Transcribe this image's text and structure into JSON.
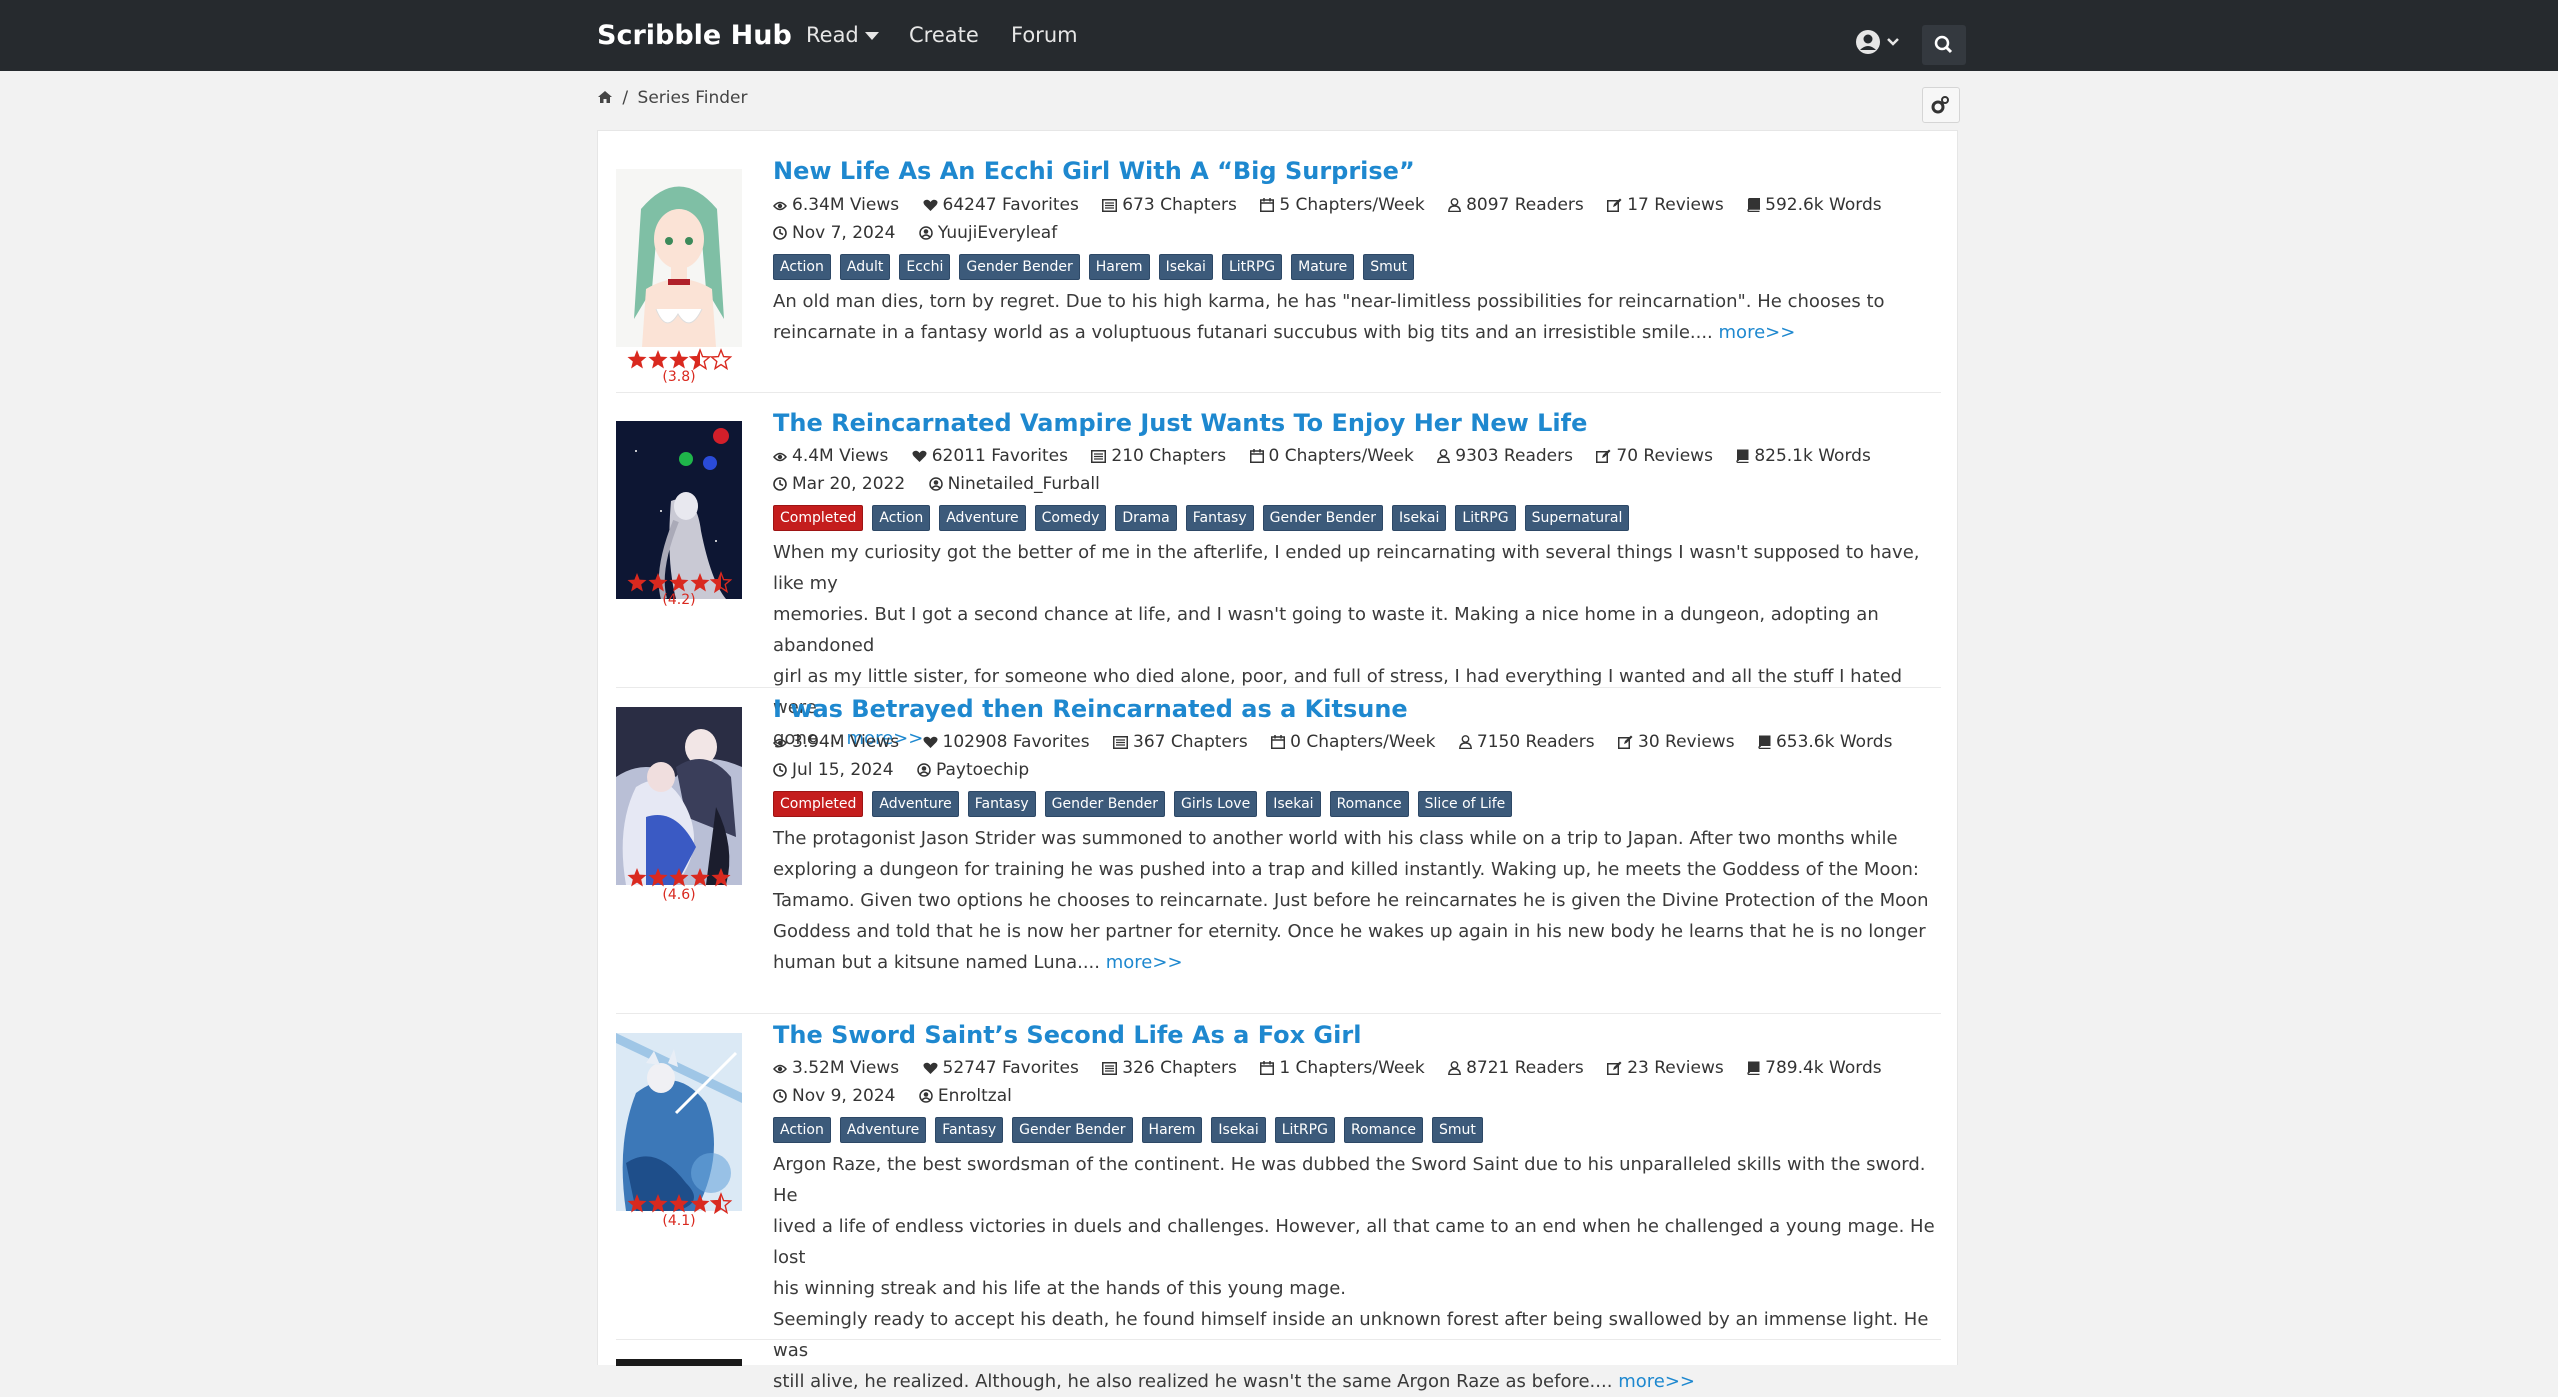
{
  "navbar": {
    "brand": "Scribble Hub",
    "links": {
      "read": "Read",
      "create": "Create",
      "forum": "Forum"
    }
  },
  "breadcrumb": {
    "home_icon": "home-icon",
    "separator": "/",
    "current": "Series Finder"
  },
  "series": [
    {
      "title": "New Life As An Ecchi Girl With A “Big Surprise”",
      "views": "6.34M Views",
      "favorites": "64247 Favorites",
      "chapters": "673 Chapters",
      "per_week": "5 Chapters/Week",
      "readers": "8097 Readers",
      "reviews": "17 Reviews",
      "words": "592.6k Words",
      "date": "Nov 7, 2024",
      "author": "YuujiEveryleaf",
      "rating": "(3.8)",
      "stars_value": 3.5,
      "tags": [
        "Action",
        "Adult",
        "Ecchi",
        "Gender Bender",
        "Harem",
        "Isekai",
        "LitRPG",
        "Mature",
        "Smut"
      ],
      "completed": "",
      "desc_lines": [
        "An old man dies, torn by regret. Due to his high karma, he has \"near-limitless possibilities for reincarnation\". He chooses to",
        "reincarnate in a fantasy world as a voluptuous futanari succubus with big tits and an irresistible smile...."
      ],
      "more": "more>>"
    },
    {
      "title": "The Reincarnated Vampire Just Wants To Enjoy Her New Life",
      "views": "4.4M Views",
      "favorites": "62011 Favorites",
      "chapters": "210 Chapters",
      "per_week": "0 Chapters/Week",
      "readers": "9303 Readers",
      "reviews": "70 Reviews",
      "words": "825.1k Words",
      "date": "Mar 20, 2022",
      "author": "Ninetailed_Furball",
      "rating": "(4.2)",
      "stars_value": 4.5,
      "completed": "Completed",
      "tags": [
        "Action",
        "Adventure",
        "Comedy",
        "Drama",
        "Fantasy",
        "Gender Bender",
        "Isekai",
        "LitRPG",
        "Supernatural"
      ],
      "desc_lines": [
        "When my curiosity got the better of me in the afterlife, I ended up reincarnating with several things I wasn't supposed to have, like my",
        "memories. But I got a second chance at life, and I wasn't going to waste it. Making a nice home in a dungeon, adopting an abandoned",
        "girl as my little sister, for someone who died alone, poor, and full of stress, I had everything I wanted and all the stuff I hated were",
        "gone...."
      ],
      "more": "more>>"
    },
    {
      "title": "I was Betrayed then Reincarnated as a Kitsune",
      "views": "3.94M Views",
      "favorites": "102908 Favorites",
      "chapters": "367 Chapters",
      "per_week": "0 Chapters/Week",
      "readers": "7150 Readers",
      "reviews": "30 Reviews",
      "words": "653.6k Words",
      "date": "Jul 15, 2024",
      "author": "Paytoechip",
      "rating": "(4.6)",
      "stars_value": 5,
      "completed": "Completed",
      "tags": [
        "Adventure",
        "Fantasy",
        "Gender Bender",
        "Girls Love",
        "Isekai",
        "Romance",
        "Slice of Life"
      ],
      "desc_lines": [
        "The protagonist Jason Strider was summoned to another world with his class while on a trip to Japan. After two months while",
        "exploring a dungeon for training he was pushed into a trap and killed instantly. Waking up, he meets the Goddess of the Moon:",
        "Tamamo. Given two options he chooses to reincarnate. Just before he reincarnates he is given the Divine Protection of the Moon",
        "Goddess and told that he is now her partner for eternity. Once he wakes up again in his new body he learns that he is no longer",
        "human but a kitsune named Luna...."
      ],
      "more": "more>>"
    },
    {
      "title": "The Sword Saint’s Second Life As a Fox Girl",
      "views": "3.52M Views",
      "favorites": "52747 Favorites",
      "chapters": "326 Chapters",
      "per_week": "1 Chapters/Week",
      "readers": "8721 Readers",
      "reviews": "23 Reviews",
      "words": "789.4k Words",
      "date": "Nov 9, 2024",
      "author": "Enroltzal",
      "rating": "(4.1)",
      "stars_value": 4.5,
      "completed": "",
      "tags": [
        "Action",
        "Adventure",
        "Fantasy",
        "Gender Bender",
        "Harem",
        "Isekai",
        "LitRPG",
        "Romance",
        "Smut"
      ],
      "desc_lines": [
        "Argon Raze, the best swordsman of the continent. He was dubbed the Sword Saint due to his unparalleled skills with the sword. He",
        "lived a life of endless victories in duels and challenges. However, all that came to an end when he challenged a young mage. He lost",
        "his winning streak and his life at the hands of this young mage.",
        "Seemingly ready to accept his death, he found himself inside an unknown forest after being swallowed by an immense light. He was",
        "still alive, he realized. Although, he also realized he wasn't the same Argon Raze as before...."
      ],
      "more": "more>>"
    }
  ],
  "colors": {
    "navbar": "#262a2e",
    "link": "#1e88cf",
    "tag": "#3c5a7a",
    "completed": "#c41d1d",
    "star": "#d9291f"
  },
  "icons": [
    "home-icon",
    "user-circle-icon",
    "search-icon",
    "cogs-icon",
    "eye-icon",
    "heart-icon",
    "list-icon",
    "calendar-icon",
    "user-icon",
    "edit-icon",
    "book-icon",
    "clock-icon",
    "author-icon",
    "star-icon"
  ]
}
